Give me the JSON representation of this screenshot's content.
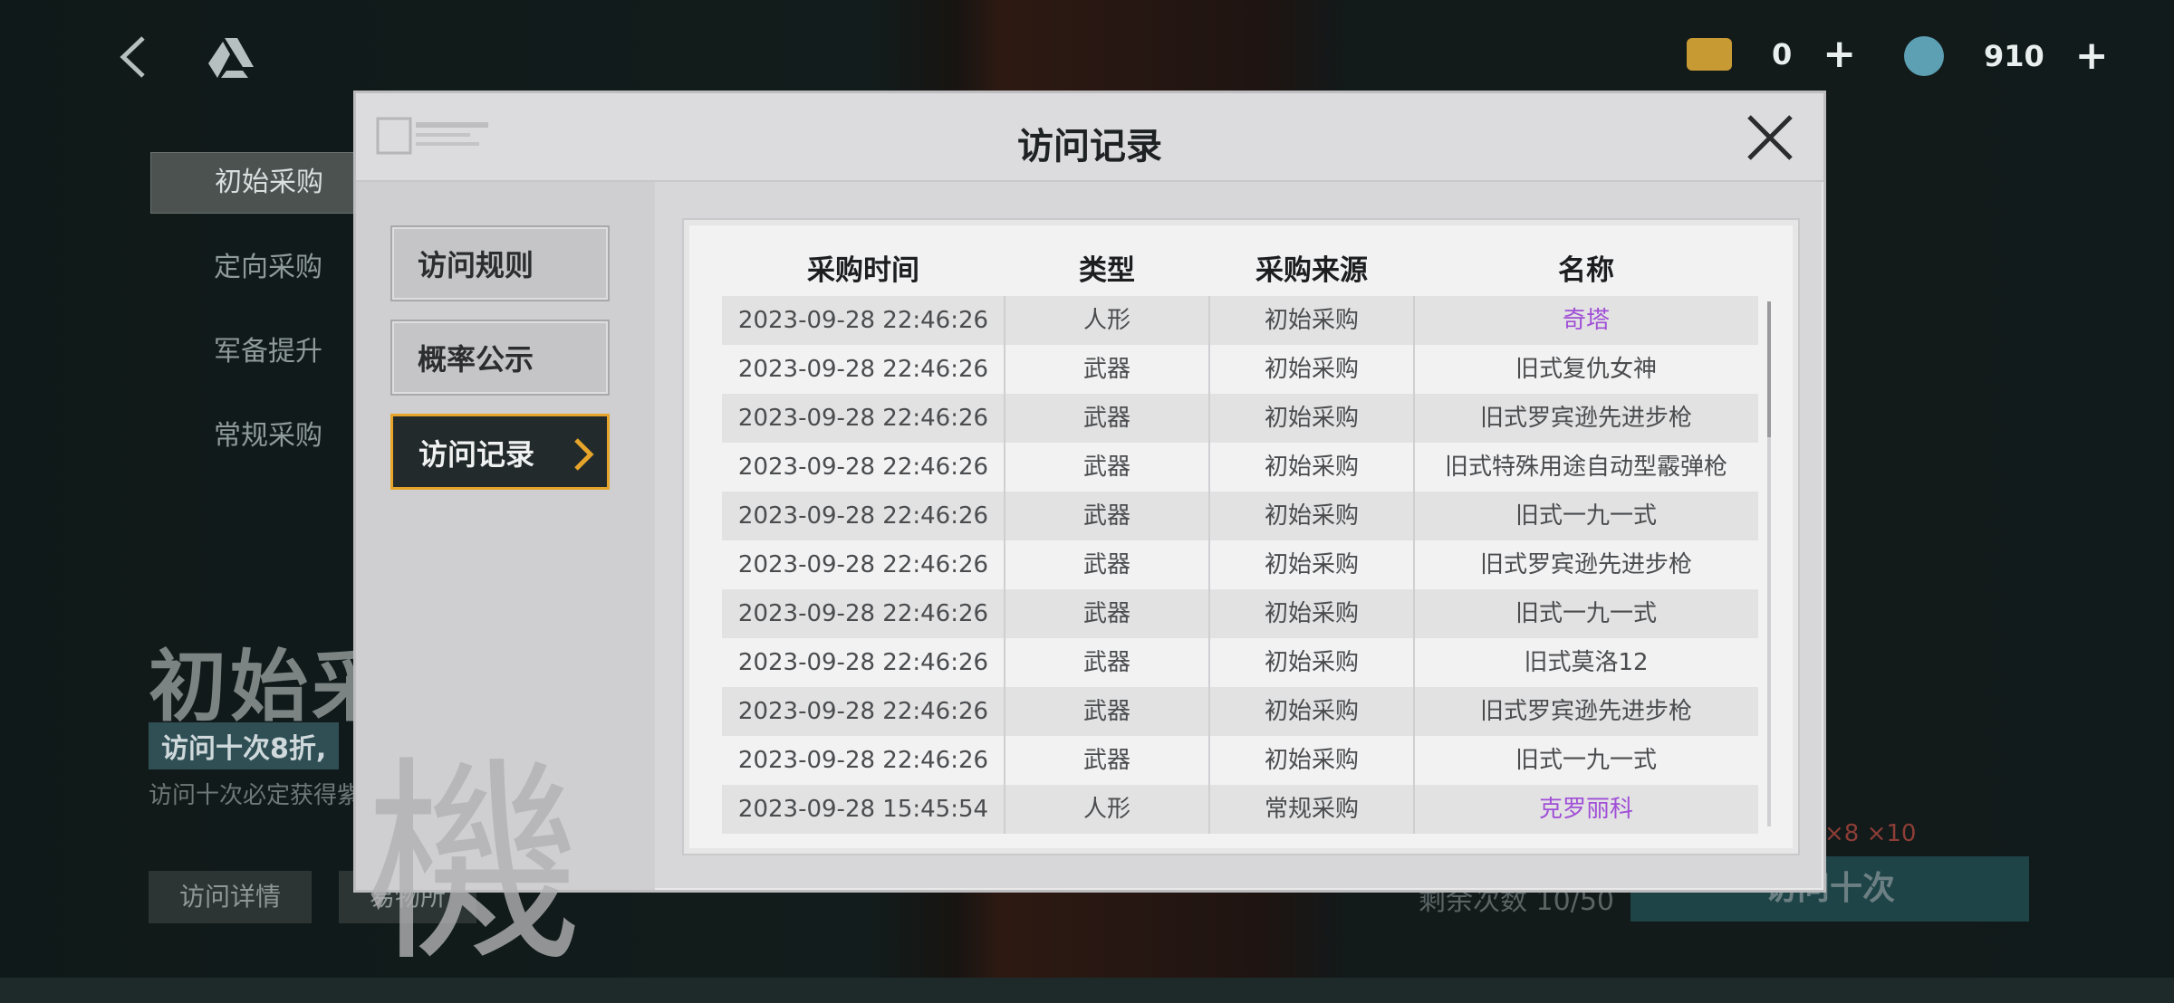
{
  "topbar": {
    "currencies": [
      {
        "name": "ticket-chip",
        "value": "0",
        "color": "#d9a83a"
      },
      {
        "name": "crystal-chip",
        "value": "910",
        "color": "#6fb6c9"
      }
    ]
  },
  "side_menu": {
    "items": [
      {
        "label": "初始采购",
        "active": true
      },
      {
        "label": "定向采购",
        "active": false
      },
      {
        "label": "军备提升",
        "active": false
      },
      {
        "label": "常规采购",
        "active": false
      }
    ]
  },
  "banner": {
    "title": "初始采",
    "tag": "访问十次8折,",
    "note": "访问十次必定获得紫",
    "price": "×8 ×10",
    "remaining": "剩余次数 10/50",
    "buttons": {
      "details": "访问详情",
      "exchange": "易物所",
      "ten_pull": "访问十次"
    }
  },
  "modal": {
    "title": "访问记录",
    "tabs": [
      {
        "label": "访问规则",
        "active": false
      },
      {
        "label": "概率公示",
        "active": false
      },
      {
        "label": "访问记录",
        "active": true
      }
    ],
    "kanji": "機",
    "accent_color": "#e6a52a",
    "rare_color": "#a04fd6",
    "table": {
      "headers": [
        "采购时间",
        "类型",
        "采购来源",
        "名称"
      ],
      "rows": [
        {
          "time": "2023-09-28 22:46:26",
          "type": "人形",
          "source": "初始采购",
          "name": "奇塔",
          "rare": true
        },
        {
          "time": "2023-09-28 22:46:26",
          "type": "武器",
          "source": "初始采购",
          "name": "旧式复仇女神",
          "rare": false
        },
        {
          "time": "2023-09-28 22:46:26",
          "type": "武器",
          "source": "初始采购",
          "name": "旧式罗宾逊先进步枪",
          "rare": false
        },
        {
          "time": "2023-09-28 22:46:26",
          "type": "武器",
          "source": "初始采购",
          "name": "旧式特殊用途自动型霰弹枪",
          "rare": false
        },
        {
          "time": "2023-09-28 22:46:26",
          "type": "武器",
          "source": "初始采购",
          "name": "旧式一九一式",
          "rare": false
        },
        {
          "time": "2023-09-28 22:46:26",
          "type": "武器",
          "source": "初始采购",
          "name": "旧式罗宾逊先进步枪",
          "rare": false
        },
        {
          "time": "2023-09-28 22:46:26",
          "type": "武器",
          "source": "初始采购",
          "name": "旧式一九一式",
          "rare": false
        },
        {
          "time": "2023-09-28 22:46:26",
          "type": "武器",
          "source": "初始采购",
          "name": "旧式莫洛12",
          "rare": false
        },
        {
          "time": "2023-09-28 22:46:26",
          "type": "武器",
          "source": "初始采购",
          "name": "旧式罗宾逊先进步枪",
          "rare": false
        },
        {
          "time": "2023-09-28 22:46:26",
          "type": "武器",
          "source": "初始采购",
          "name": "旧式一九一式",
          "rare": false
        },
        {
          "time": "2023-09-28 15:45:54",
          "type": "人形",
          "source": "常规采购",
          "name": "克罗丽科",
          "rare": true
        }
      ]
    }
  }
}
